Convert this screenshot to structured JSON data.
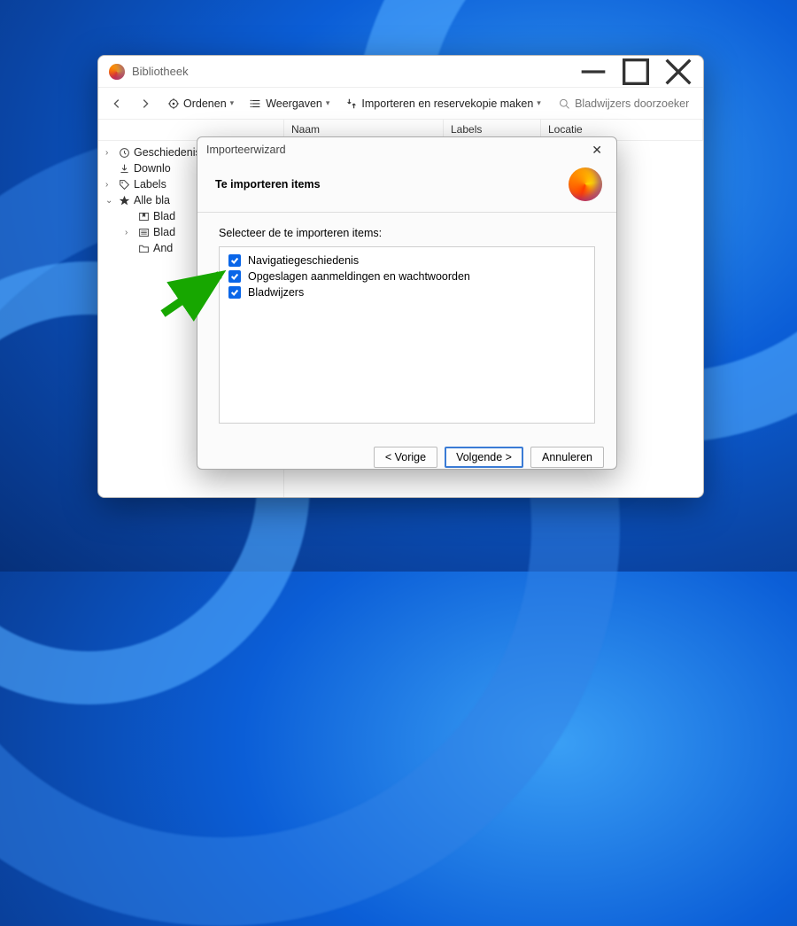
{
  "window": {
    "title": "Bibliotheek"
  },
  "toolbar": {
    "ordenen": "Ordenen",
    "weergaven": "Weergaven",
    "importeren": "Importeren en reservekopie maken",
    "search_placeholder": "Bladwijzers doorzoeken"
  },
  "columns": {
    "naam": "Naam",
    "labels": "Labels",
    "locatie": "Locatie"
  },
  "sidebar": {
    "geschiedenis": "Geschiedenis",
    "downloads": "Downlo",
    "labels": "Labels",
    "alle": "Alle bla",
    "sub_bookmarks": "Blad",
    "sub_bookmarks2": "Blad",
    "sub_andere": "And"
  },
  "wizard": {
    "title": "Importeerwizard",
    "heading": "Te importeren items",
    "prompt": "Selecteer de te importeren items:",
    "items": [
      {
        "label": "Navigatiegeschiedenis",
        "checked": true
      },
      {
        "label": "Opgeslagen aanmeldingen en wachtwoorden",
        "checked": true
      },
      {
        "label": "Bladwijzers",
        "checked": true
      }
    ],
    "buttons": {
      "back": "< Vorige",
      "next": "Volgende >",
      "cancel": "Annuleren"
    }
  }
}
